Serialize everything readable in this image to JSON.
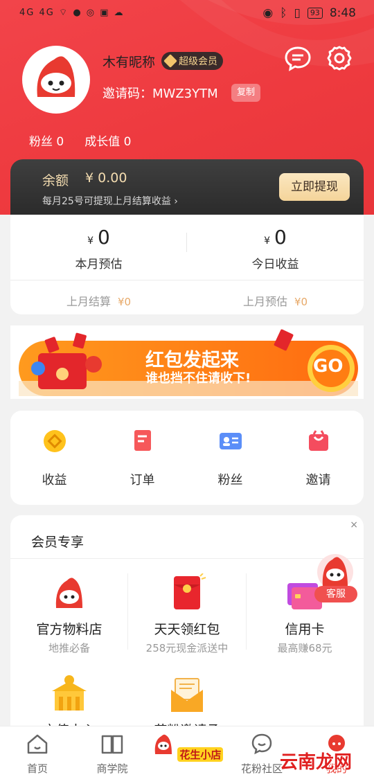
{
  "status_bar": {
    "left": "4G 4G",
    "battery": "93",
    "time": "8:48"
  },
  "profile": {
    "nickname": "木有昵称",
    "vip_badge": "超级会员",
    "invite_label": "邀请码：",
    "invite_code": "MWZ3YTM",
    "copy_label": "复制",
    "fans_label": "粉丝",
    "fans_value": "0",
    "growth_label": "成长值",
    "growth_value": "0"
  },
  "balance": {
    "label": "余额",
    "amount": "¥ 0.00",
    "tip": "每月25号可提现上月结算收益",
    "withdraw_button": "立即提现"
  },
  "earnings": {
    "month_estimate_value": "0",
    "month_estimate_label": "本月预估",
    "today_value": "0",
    "today_label": "今日收益",
    "currency": "¥",
    "last_settle_label": "上月结算",
    "last_settle_value": "¥0",
    "last_estimate_label": "上月预估",
    "last_estimate_value": "¥0"
  },
  "banner": {
    "headline": "红包发起来",
    "subline": "谁也挡不住请收下!",
    "go": "GO"
  },
  "quick_actions": [
    {
      "label": "收益",
      "icon": "coin-icon"
    },
    {
      "label": "订单",
      "icon": "order-icon"
    },
    {
      "label": "粉丝",
      "icon": "id-card-icon"
    },
    {
      "label": "邀请",
      "icon": "gift-icon"
    }
  ],
  "member": {
    "title": "会员专享",
    "close": "×",
    "items": [
      {
        "name": "官方物料店",
        "desc": "地推必备"
      },
      {
        "name": "天天领红包",
        "desc": "258元现金派送中"
      },
      {
        "name": "信用卡",
        "desc": "最高赚68元"
      },
      {
        "name": "充值中心",
        "desc": ""
      },
      {
        "name": "花粉邀请函",
        "desc": ""
      }
    ],
    "service_label": "客服"
  },
  "tabbar": [
    {
      "label": "首页"
    },
    {
      "label": "商学院"
    },
    {
      "label": "花生小店"
    },
    {
      "label": "花粉社区"
    },
    {
      "label": "我的"
    }
  ],
  "watermark": "云南龙网",
  "colors": {
    "brand_red": "#ee3a3f",
    "gold": "#f3dcb0",
    "dark": "#2b2b2b"
  }
}
